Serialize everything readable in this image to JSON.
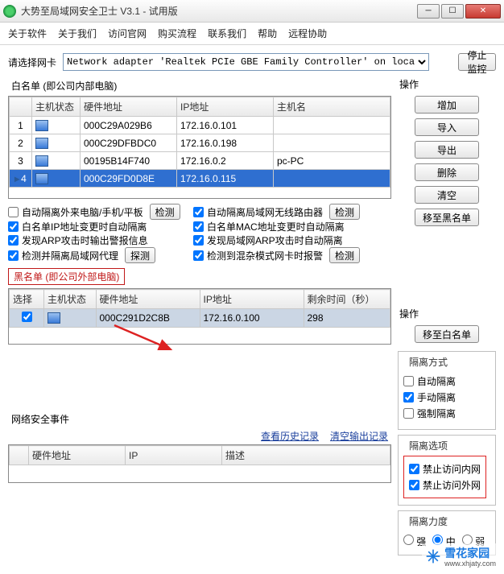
{
  "window": {
    "title": "大势至局域网安全卫士 V3.1 - 试用版"
  },
  "menu": [
    "关于软件",
    "关于我们",
    "访问官网",
    "购买流程",
    "联系我们",
    "帮助",
    "远程协助"
  ],
  "nic": {
    "label": "请选择网卡",
    "selected": "Network adapter 'Realtek PCIe GBE Family Controller' on loca",
    "stop_btn": "停止监控"
  },
  "whitelist": {
    "title": "白名单 (即公司内部电脑)",
    "cols": {
      "idx": "",
      "host": "主机状态",
      "mac": "硬件地址",
      "ip": "IP地址",
      "name": "主机名"
    },
    "rows": [
      {
        "n": "1",
        "mac": "000C29A029B6",
        "ip": "172.16.0.101",
        "name": ""
      },
      {
        "n": "2",
        "mac": "000C29DFBDC0",
        "ip": "172.16.0.198",
        "name": ""
      },
      {
        "n": "3",
        "mac": "00195B14F740",
        "ip": "172.16.0.2",
        "name": "pc-PC"
      },
      {
        "n": "4",
        "mac": "000C29FD0D8E",
        "ip": "172.16.0.115",
        "name": "",
        "selected": true
      }
    ]
  },
  "ops": {
    "title": "操作",
    "add": "增加",
    "import": "导入",
    "export": "导出",
    "delete": "删除",
    "clear": "清空",
    "to_black": "移至黑名单",
    "to_white": "移至白名单"
  },
  "opts": {
    "iso_ext": "自动隔离外来电脑/手机/平板",
    "detect": "检测",
    "iso_router": "自动隔离局域网无线路由器",
    "wl_ip_change": "白名单IP地址变更时自动隔离",
    "wl_mac_change": "白名单MAC地址变更时自动隔离",
    "arp_alert": "发现ARP攻击时输出警报信息",
    "arp_iso": "发现局域网ARP攻击时自动隔离",
    "proxy": "检测并隔离局域网代理",
    "probe": "探测",
    "promisc": "检测到混杂模式网卡时报警"
  },
  "blacklist": {
    "title": "黑名单 (即公司外部电脑)",
    "cols": {
      "sel": "选择",
      "host": "主机状态",
      "mac": "硬件地址",
      "ip": "IP地址",
      "time": "剩余时间（秒）"
    },
    "rows": [
      {
        "mac": "000C291D2C8B",
        "ip": "172.16.0.100",
        "time": "298"
      }
    ]
  },
  "iso_mode": {
    "title": "隔离方式",
    "auto": "自动隔离",
    "manual": "手动隔离",
    "force": "强制隔离"
  },
  "iso_opt": {
    "title": "隔离选项",
    "no_intra": "禁止访问内网",
    "no_inter": "禁止访问外网"
  },
  "iso_level": {
    "title": "隔离力度",
    "strong": "强",
    "mid": "中",
    "weak": "弱"
  },
  "events": {
    "title": "网络安全事件",
    "history": "查看历史记录",
    "clear": "清空输出记录",
    "cols": {
      "mac": "硬件地址",
      "ip": "IP",
      "desc": "描述"
    }
  },
  "watermark": {
    "name": "雪花家园",
    "url": "www.xhjaty.com"
  }
}
